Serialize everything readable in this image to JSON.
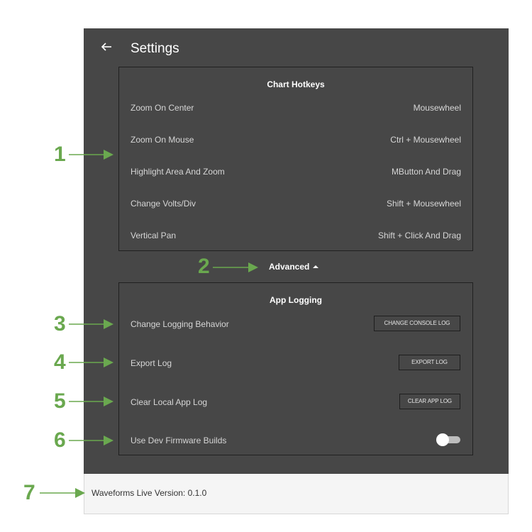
{
  "header": {
    "title": "Settings"
  },
  "hotkeys": {
    "title": "Chart Hotkeys",
    "rows": [
      {
        "label": "Zoom On Center",
        "value": "Mousewheel"
      },
      {
        "label": "Zoom On Mouse",
        "value": "Ctrl + Mousewheel"
      },
      {
        "label": "Highlight Area And Zoom",
        "value": "MButton And Drag"
      },
      {
        "label": "Change Volts/Div",
        "value": "Shift + Mousewheel"
      },
      {
        "label": "Vertical Pan",
        "value": "Shift + Click And Drag"
      }
    ]
  },
  "advanced": {
    "label": "Advanced",
    "expanded": true
  },
  "logging": {
    "title": "App Logging",
    "rows": [
      {
        "label": "Change Logging Behavior",
        "button": "CHANGE CONSOLE LOG"
      },
      {
        "label": "Export Log",
        "button": "EXPORT LOG"
      },
      {
        "label": "Clear Local App Log",
        "button": "CLEAR APP LOG"
      },
      {
        "label": "Use Dev Firmware Builds",
        "toggle_on": false
      }
    ]
  },
  "footer": {
    "version_text": "Waveforms Live Version: 0.1.0"
  },
  "annotations": [
    "1",
    "2",
    "3",
    "4",
    "5",
    "6",
    "7"
  ],
  "colors": {
    "panel": "#474747",
    "annotation": "#6aa84f",
    "footer": "#f5f5f5"
  },
  "icons": {
    "back": "arrow-left-icon",
    "expand": "caret-up-icon"
  }
}
